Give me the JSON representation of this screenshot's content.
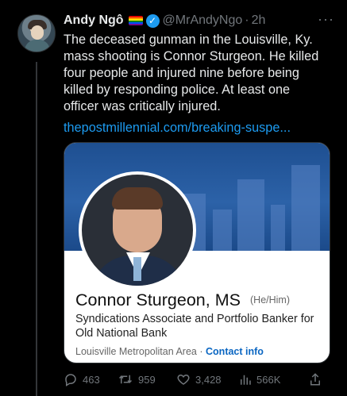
{
  "tweet": {
    "author_name": "Andy Ngô",
    "handle": "@MrAndyNgo",
    "separator": "·",
    "time": "2h",
    "more_label": "···",
    "text": "The deceased gunman in the Louisville, Ky. mass shooting is Connor Sturgeon. He killed four people and injured nine before being killed by responding police. At least one officer was critically injured.",
    "link": "thepostmillennial.com/breaking-suspe..."
  },
  "card": {
    "name": "Connor Sturgeon, MS",
    "pronouns": "(He/Him)",
    "headline": "Syndications Associate and Portfolio Banker for Old National Bank",
    "location": "Louisville Metropolitan Area",
    "meta_separator": "·",
    "contact": "Contact info"
  },
  "actions": {
    "replies": "463",
    "retweets": "959",
    "likes": "3,428",
    "views": "566K"
  },
  "colors": {
    "background": "#000000",
    "text": "#e7e9ea",
    "muted": "#71767b",
    "link": "#1d9bf0",
    "verified": "#1d9bf0",
    "card_link": "#0a66c2"
  },
  "icons": [
    "pride-flag-icon",
    "verified-badge-icon",
    "more-icon",
    "reply-icon",
    "retweet-icon",
    "like-icon",
    "views-icon",
    "share-icon"
  ]
}
